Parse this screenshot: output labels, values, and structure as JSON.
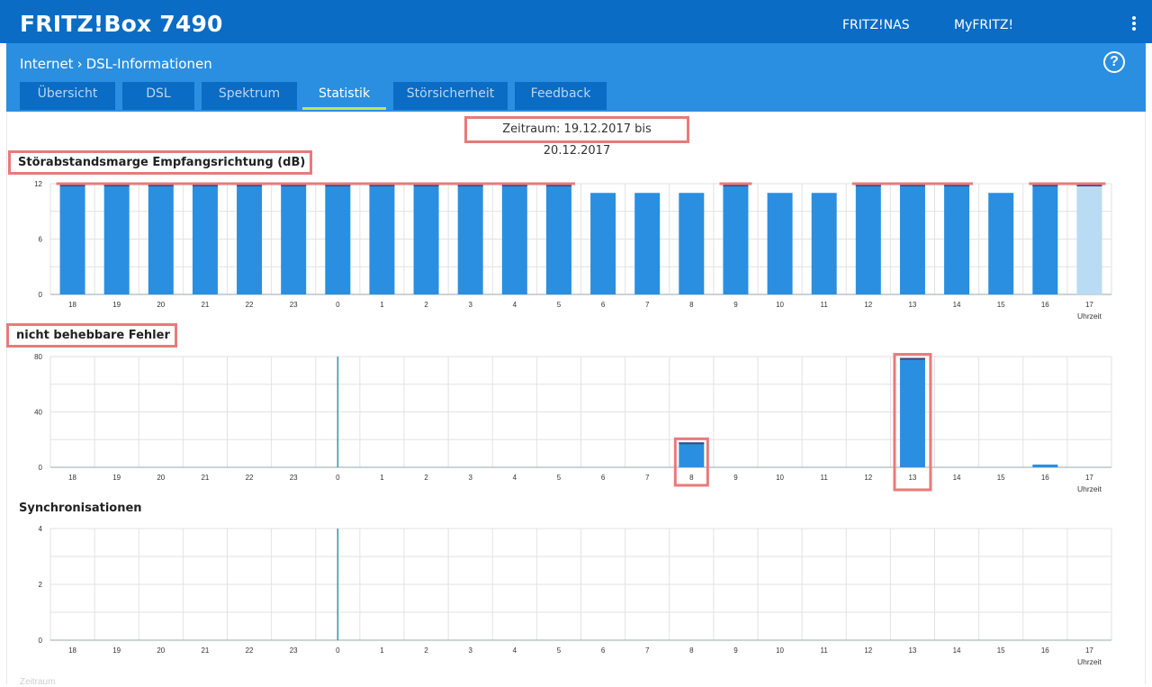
{
  "header": {
    "product": "FRITZ!Box 7490",
    "links": [
      "FRITZ!NAS",
      "MyFRITZ!"
    ],
    "menu_icon": "kebab-menu-icon"
  },
  "breadcrumb": {
    "parent": "Internet",
    "separator": "›",
    "current": "DSL-Informationen"
  },
  "help_icon": "?",
  "tabs": [
    {
      "label": "Übersicht",
      "active": false
    },
    {
      "label": "DSL",
      "active": false
    },
    {
      "label": "Spektrum",
      "active": false
    },
    {
      "label": "Statistik",
      "active": true
    },
    {
      "label": "Störsicherheit",
      "active": false
    },
    {
      "label": "Feedback",
      "active": false
    }
  ],
  "period": "Zeitraum: 19.12.2017 bis 20.12.2017",
  "colors": {
    "header": "#0a6cc4",
    "subheader": "#2a8fe0",
    "bar": "#2a8fe0",
    "bar_current": "#b9dbf3",
    "bar_min": "#4a3f7a",
    "highlight": "#e97a7a",
    "active_tab_underline": "#c8e34a"
  },
  "footer_label": "Zeitraum",
  "chart_data": [
    {
      "type": "bar",
      "title": "Störabstandsmarge Empfangsrichtung (dB)",
      "xlabel": "Uhrzeit",
      "categories": [
        "18",
        "19",
        "20",
        "21",
        "22",
        "23",
        "0",
        "1",
        "2",
        "3",
        "4",
        "5",
        "6",
        "7",
        "8",
        "9",
        "10",
        "11",
        "12",
        "13",
        "14",
        "15",
        "16",
        "17"
      ],
      "values": [
        12,
        12,
        12,
        12,
        12,
        12,
        12,
        12,
        12,
        12,
        12,
        12,
        11,
        11,
        11,
        12,
        11,
        11,
        12,
        12,
        12,
        11,
        12,
        12
      ],
      "ylim": [
        0,
        12
      ],
      "yticks": [
        0,
        6,
        12
      ],
      "current_hour_index": 23
    },
    {
      "type": "bar",
      "title": "nicht behebbare Fehler",
      "xlabel": "Uhrzeit",
      "categories": [
        "18",
        "19",
        "20",
        "21",
        "22",
        "23",
        "0",
        "1",
        "2",
        "3",
        "4",
        "5",
        "6",
        "7",
        "8",
        "9",
        "10",
        "11",
        "12",
        "13",
        "14",
        "15",
        "16",
        "17"
      ],
      "values": [
        0,
        0,
        0,
        0,
        0,
        0,
        0,
        0,
        0,
        0,
        0,
        0,
        0,
        0,
        18,
        0,
        0,
        0,
        0,
        79,
        0,
        0,
        2,
        0
      ],
      "ylim": [
        0,
        80
      ],
      "yticks": [
        0,
        40,
        80
      ],
      "day_marker_index": 6
    },
    {
      "type": "bar",
      "title": "Synchronisationen",
      "xlabel": "Uhrzeit",
      "categories": [
        "18",
        "19",
        "20",
        "21",
        "22",
        "23",
        "0",
        "1",
        "2",
        "3",
        "4",
        "5",
        "6",
        "7",
        "8",
        "9",
        "10",
        "11",
        "12",
        "13",
        "14",
        "15",
        "16",
        "17"
      ],
      "values": [
        0,
        0,
        0,
        0,
        0,
        0,
        0,
        0,
        0,
        0,
        0,
        0,
        0,
        0,
        0,
        0,
        0,
        0,
        0,
        0,
        0,
        0,
        0,
        0
      ],
      "ylim": [
        0,
        4
      ],
      "yticks": [
        0,
        2,
        4
      ],
      "day_marker_index": 6
    }
  ]
}
